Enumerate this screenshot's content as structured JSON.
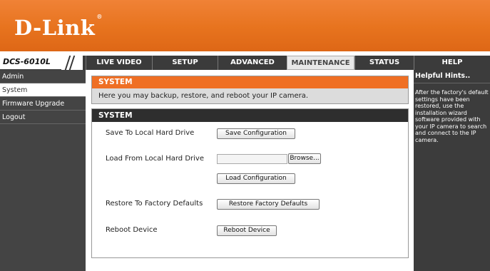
{
  "brand": {
    "logo": "D-Link",
    "trademark": "®"
  },
  "model": "DCS-6010L",
  "nav": {
    "tabs": [
      {
        "label": "LIVE VIDEO"
      },
      {
        "label": "SETUP"
      },
      {
        "label": "ADVANCED"
      },
      {
        "label": "MAINTENANCE"
      },
      {
        "label": "STATUS"
      },
      {
        "label": "HELP"
      }
    ],
    "active": "MAINTENANCE"
  },
  "sidebar": {
    "items": [
      {
        "label": "Admin"
      },
      {
        "label": "System"
      },
      {
        "label": "Firmware Upgrade"
      },
      {
        "label": "Logout"
      }
    ],
    "active": "System"
  },
  "system_section": {
    "title": "SYSTEM",
    "description": "Here you may backup, restore, and reboot your IP camera."
  },
  "system_panel": {
    "title": "SYSTEM",
    "save_label": "Save To Local Hard Drive",
    "save_button": "Save Configuration",
    "load_label": "Load From Local Hard Drive",
    "browse_button": "Browse...",
    "load_button": "Load Configuration",
    "restore_label": "Restore To Factory Defaults",
    "restore_button": "Restore Factory Defaults",
    "reboot_label": "Reboot Device",
    "reboot_button": "Reboot Device"
  },
  "hints": {
    "title": "Helpful Hints..",
    "text": "After the factory's default settings have been restored, use the installation wizard software provided with your IP camera to search and connect to the IP camera."
  },
  "colors": {
    "accent": "#ef6f24",
    "nav_bg": "#3b3b3b",
    "panel_bg": "#2e2e2e"
  }
}
